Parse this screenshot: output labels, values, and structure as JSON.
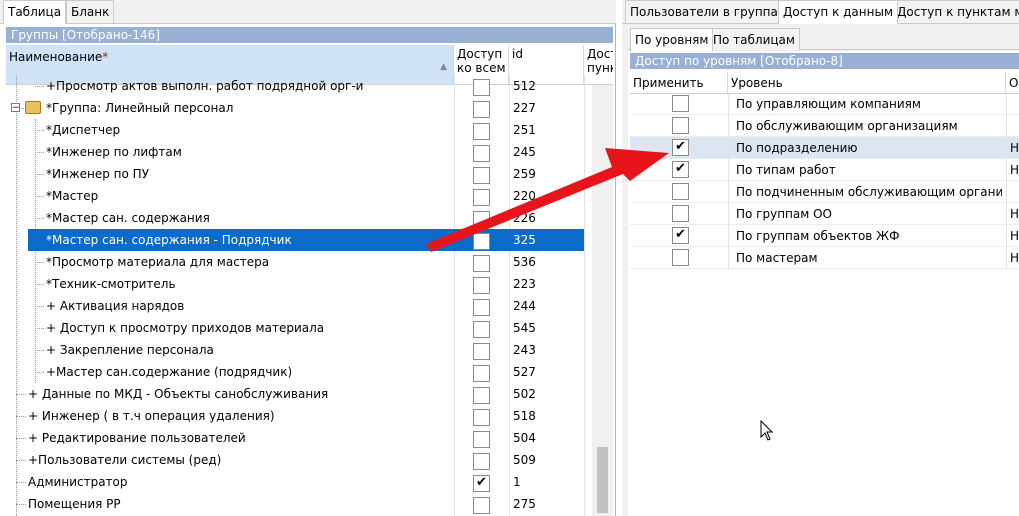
{
  "left": {
    "tabs": [
      "Таблица",
      "Бланк"
    ],
    "group_bar": "Группы  [Отобрано-146]",
    "columns": {
      "name": "Наименование",
      "required_mark": "*",
      "access_line1": "Доступ",
      "access_line2": "ко всем",
      "id": "id",
      "extra_line1": "Досту",
      "extra_line2": "пунк"
    },
    "rows": [
      {
        "label": "+Просмотр актов выполн. работ подрядной орг-и",
        "id": "512",
        "checked": false,
        "indent": 2
      },
      {
        "label": "*Группа: Линейный персонал",
        "id": "227",
        "checked": false,
        "indent": 1,
        "group": true
      },
      {
        "label": "*Диспетчер",
        "id": "251",
        "checked": false,
        "indent": 2
      },
      {
        "label": "*Инженер по лифтам",
        "id": "245",
        "checked": false,
        "indent": 2
      },
      {
        "label": "*Инженер по ПУ",
        "id": "259",
        "checked": false,
        "indent": 2
      },
      {
        "label": "*Мастер",
        "id": "220",
        "checked": false,
        "indent": 2
      },
      {
        "label": "*Мастер сан. содержания",
        "id": "226",
        "checked": false,
        "indent": 2
      },
      {
        "label": "*Мастер сан. содержания - Подрядчик",
        "id": "325",
        "checked": false,
        "indent": 2,
        "selected": true
      },
      {
        "label": "*Просмотр материала для мастера",
        "id": "536",
        "checked": false,
        "indent": 2
      },
      {
        "label": "*Техник-смотритель",
        "id": "223",
        "checked": false,
        "indent": 2
      },
      {
        "label": "+ Активация нарядов",
        "id": "244",
        "checked": false,
        "indent": 2
      },
      {
        "label": "+ Доступ к просмотру приходов материала",
        "id": "545",
        "checked": false,
        "indent": 2
      },
      {
        "label": "+ Закрепление персонала",
        "id": "243",
        "checked": false,
        "indent": 2
      },
      {
        "label": "+Мастер сан.содержание (подрядчик)",
        "id": "527",
        "checked": false,
        "indent": 2
      },
      {
        "label": "+ Данные по МКД - Объекты санобслуживания",
        "id": "502",
        "checked": false,
        "indent": 1
      },
      {
        "label": "+ Инженер ( в т.ч операция удаления)",
        "id": "518",
        "checked": false,
        "indent": 1
      },
      {
        "label": "+ Редактирование пользователей",
        "id": "504",
        "checked": false,
        "indent": 1
      },
      {
        "label": "+Пользователи системы (ред)",
        "id": "509",
        "checked": false,
        "indent": 1
      },
      {
        "label": "Администратор",
        "id": "1",
        "checked": true,
        "indent": 1
      },
      {
        "label": "Помещения РР",
        "id": "275",
        "checked": false,
        "indent": 1
      }
    ]
  },
  "right": {
    "tabs": [
      "Пользователи в группах",
      "Доступ к данным",
      "Доступ к пунктам ме"
    ],
    "subtabs": [
      "По уровням",
      "По таблицам"
    ],
    "group_bar": "Доступ по уровням  [Отобрано-8]",
    "columns": {
      "apply": "Применить",
      "level": "Уровень",
      "extra": "О"
    },
    "rows": [
      {
        "label": "По управляющим компаниям",
        "checked": false,
        "extra": ""
      },
      {
        "label": "По обслуживающим организациям",
        "checked": false,
        "extra": ""
      },
      {
        "label": "По подразделению",
        "checked": true,
        "extra": "Н",
        "selected": true
      },
      {
        "label": "По типам работ",
        "checked": true,
        "extra": "Н"
      },
      {
        "label": "По подчиненным обслуживающим организац",
        "checked": false,
        "extra": ""
      },
      {
        "label": "По группам ОО",
        "checked": false,
        "extra": "Н"
      },
      {
        "label": "По группам объектов ЖФ",
        "checked": true,
        "extra": "Н"
      },
      {
        "label": "По мастерам",
        "checked": false,
        "extra": "Н"
      }
    ]
  },
  "colors": {
    "selection": "#0c6bc8",
    "header_blue": "#98b0d3",
    "sort_header": "#cfe2f6",
    "arrow": "#e8141c"
  }
}
